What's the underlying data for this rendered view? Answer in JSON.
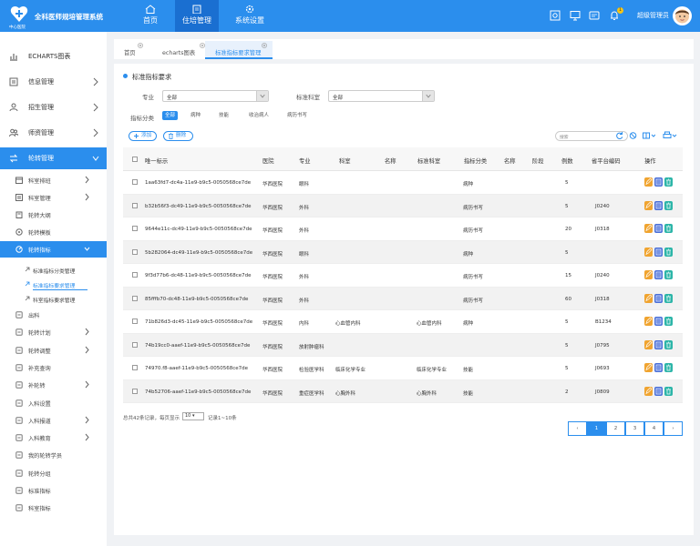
{
  "app": {
    "title": "全科医师规培管理系统",
    "subtitle": "中心医院",
    "admin": "超级管理员",
    "badge": "1"
  },
  "topnav": [
    {
      "label": "首页",
      "icon": "home-icon"
    },
    {
      "label": "住培管理",
      "icon": "clipboard-icon"
    },
    {
      "label": "系统设置",
      "icon": "gear-icon"
    }
  ],
  "sidebar": {
    "items": [
      {
        "label": "ECHARTS图表"
      },
      {
        "label": "信息管理"
      },
      {
        "label": "招生管理"
      },
      {
        "label": "师资管理"
      },
      {
        "label": "轮转管理"
      }
    ],
    "sub": [
      {
        "label": "科室排班"
      },
      {
        "label": "科室管理"
      },
      {
        "label": "轮转大纲"
      },
      {
        "label": "轮转模板"
      },
      {
        "label": "轮转指标"
      }
    ],
    "sub3": [
      {
        "label": "标准指标分类管理"
      },
      {
        "label": "标准指标要求管理"
      },
      {
        "label": "科室指标要求管理"
      }
    ],
    "more": [
      {
        "label": "出科"
      },
      {
        "label": "轮转计划"
      },
      {
        "label": "轮转调整"
      },
      {
        "label": "补充查询"
      },
      {
        "label": "补轮转"
      },
      {
        "label": "入科设置"
      },
      {
        "label": "入科报道"
      },
      {
        "label": "入科教育"
      },
      {
        "label": "我的轮转学员"
      },
      {
        "label": "轮转分组"
      },
      {
        "label": "标准指标"
      },
      {
        "label": "科室指标"
      }
    ]
  },
  "tabs": [
    {
      "label": "首页"
    },
    {
      "label": "echarts图表"
    },
    {
      "label": "标准指标要求管理"
    }
  ],
  "page": {
    "title": "标准指标要求"
  },
  "filters": {
    "major_label": "专业",
    "major_value": "全部",
    "dept_label": "标准科室",
    "dept_value": "全部",
    "category_label": "指标分类",
    "categories": [
      "全部",
      "病种",
      "技能",
      "收治病人",
      "病历书写"
    ]
  },
  "toolbar": {
    "add": "添加",
    "delete": "删除",
    "search_placeholder": "搜索"
  },
  "table": {
    "headers": [
      "唯一标示",
      "医院",
      "专业",
      "科室",
      "名称",
      "标准科室",
      "指标分类",
      "名称",
      "阶段",
      "例数",
      "省平台编码",
      "操作"
    ],
    "rows": [
      {
        "id": "1aa63fd7-dc4a-11e9-b9c5-0050568ce7de",
        "hospital": "华西医院",
        "major": "眼科",
        "dept": "",
        "name": "",
        "std_dept": "",
        "category": "病种",
        "name2": "",
        "stage": "",
        "count": "5",
        "code": ""
      },
      {
        "id": "b32b56f3-dc49-11e9-b9c5-0050568ce7de",
        "hospital": "华西医院",
        "major": "外科",
        "dept": "",
        "name": "",
        "std_dept": "",
        "category": "病历书写",
        "name2": "",
        "stage": "",
        "count": "5",
        "code": "J0240"
      },
      {
        "id": "9644e11c-dc49-11e9-b9c5-0050568ce7de",
        "hospital": "华西医院",
        "major": "外科",
        "dept": "",
        "name": "",
        "std_dept": "",
        "category": "病历书写",
        "name2": "",
        "stage": "",
        "count": "20",
        "code": "J0318"
      },
      {
        "id": "5b282064-dc49-11e9-b9c5-0050568ce7de",
        "hospital": "华西医院",
        "major": "眼科",
        "dept": "",
        "name": "",
        "std_dept": "",
        "category": "病种",
        "name2": "",
        "stage": "",
        "count": "5",
        "code": ""
      },
      {
        "id": "9f3d77b6-dc48-11e9-b9c5-0050568ce7de",
        "hospital": "华西医院",
        "major": "外科",
        "dept": "",
        "name": "",
        "std_dept": "",
        "category": "病历书写",
        "name2": "",
        "stage": "",
        "count": "15",
        "code": "J0240"
      },
      {
        "id": "85fffb70-dc48-11e9-b9c5-0050568ce7de",
        "hospital": "华西医院",
        "major": "外科",
        "dept": "",
        "name": "",
        "std_dept": "",
        "category": "病历书写",
        "name2": "",
        "stage": "",
        "count": "60",
        "code": "J0318"
      },
      {
        "id": "71b826d3-dc45-11e9-b9c5-0050568ce7de",
        "hospital": "华西医院",
        "major": "内科",
        "dept": "心血管内科",
        "name": "",
        "std_dept": "心血管内科",
        "category": "病种",
        "name2": "",
        "stage": "",
        "count": "5",
        "code": "B1234"
      },
      {
        "id": "74b19cc0-aaef-11e9-b9c5-0050568ce7de",
        "hospital": "华西医院",
        "major": "放射肿瘤科",
        "dept": "",
        "name": "",
        "std_dept": "",
        "category": "",
        "name2": "",
        "stage": "",
        "count": "5",
        "code": "J0795"
      },
      {
        "id": "74970.f8-aaef-11e9-b9c5-0050568ce7de",
        "hospital": "华西医院",
        "major": "检验医学科",
        "dept": "临床化学专业",
        "name": "",
        "std_dept": "临床化学专业",
        "category": "技能",
        "name2": "",
        "stage": "",
        "count": "5",
        "code": "J0693"
      },
      {
        "id": "74b52706-aaef-11e9-b9c5-0050568ce7de",
        "hospital": "华西医院",
        "major": "重症医学科",
        "dept": "心胸外科",
        "name": "",
        "std_dept": "心胸外科",
        "category": "技能",
        "name2": "",
        "stage": "",
        "count": "2",
        "code": "J0809"
      }
    ]
  },
  "pagination": {
    "info_prefix": "总共42条记录，每页显示",
    "page_size": "10",
    "info_suffix": "记录1~10条",
    "pages": [
      "1",
      "2",
      "3",
      "4"
    ],
    "prev": "‹",
    "next": "›"
  },
  "colors": {
    "primary": "#2b8eed",
    "op_edit": "#f0a430",
    "op_view": "#4a6fd8",
    "op_delete": "#2cb5a8"
  }
}
